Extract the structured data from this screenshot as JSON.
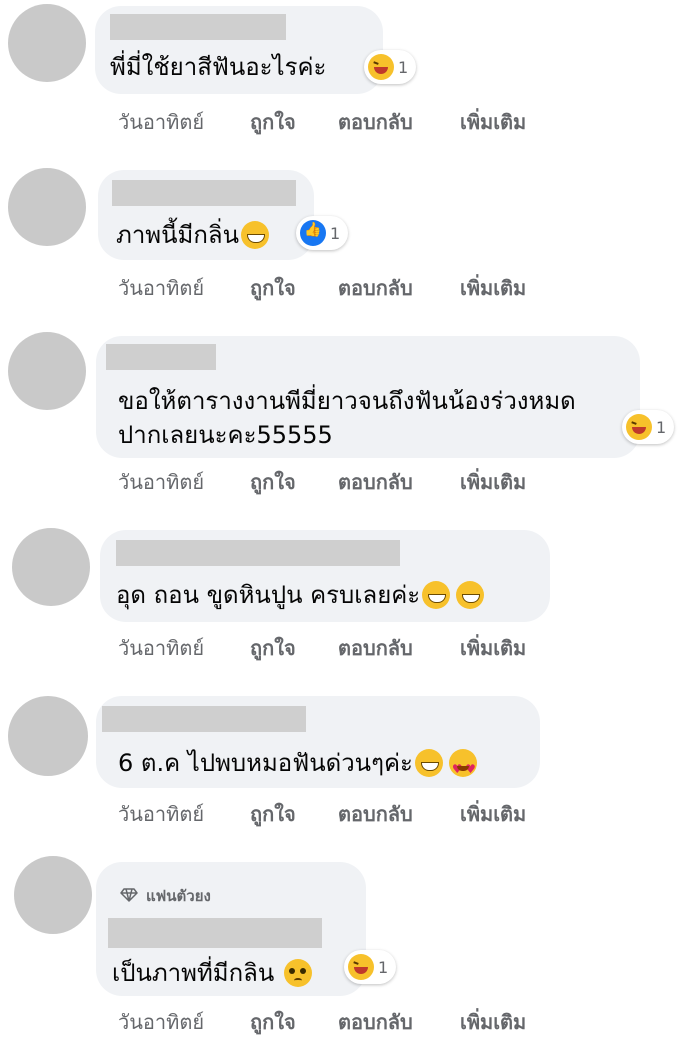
{
  "actions": {
    "time": "วันอาทิตย์",
    "like": "ถูกใจ",
    "reply": "ตอบกลับ",
    "more": "เพิ่มเติม"
  },
  "comments": [
    {
      "lines": [
        "พี่มี่ใช้ยาสีฟันอะไรค่ะ"
      ],
      "inline_emoji": [],
      "reactions": [
        {
          "icon": "laughing-reaction-icon",
          "count": "1"
        }
      ]
    },
    {
      "lines": [
        "ภาพนี้มีกลิ่น"
      ],
      "inline_emoji": [
        "grinning-emoji-icon"
      ],
      "reactions": [
        {
          "icon": "like-reaction-icon",
          "count": "1"
        }
      ]
    },
    {
      "lines": [
        "ขอให้ตารางงานพีมี่ยาวจนถึงฟันน้องร่วงหมด",
        "ปากเลยนะคะ55555"
      ],
      "inline_emoji": [],
      "reactions": [
        {
          "icon": "laughing-reaction-icon",
          "count": "1"
        }
      ]
    },
    {
      "lines": [
        "อุด ถอน ขูดหินปูน ครบเลยค่ะ"
      ],
      "inline_emoji": [
        "grinning-emoji-icon",
        "grinning-emoji-icon"
      ],
      "reactions": []
    },
    {
      "lines": [
        "6 ต.ค ไปพบหมอฟันด่วนๆค่ะ"
      ],
      "inline_emoji": [
        "grinning-emoji-icon",
        "heart-eyes-emoji-icon"
      ],
      "reactions": []
    },
    {
      "badge": "แฟนตัวยง",
      "lines": [
        "เป็นภาพที่มีกลิน"
      ],
      "inline_emoji": [
        "pleading-emoji-icon"
      ],
      "reactions": [
        {
          "icon": "laughing-reaction-icon",
          "count": "1"
        }
      ]
    }
  ]
}
